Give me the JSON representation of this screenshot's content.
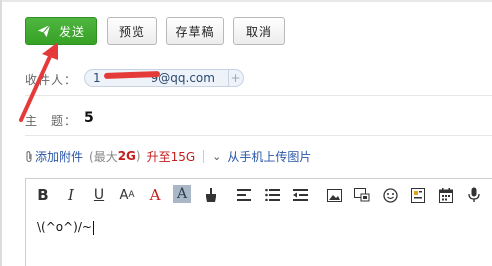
{
  "toolbar": {
    "send_label": "发送",
    "preview_label": "预览",
    "draft_label": "存草稿",
    "cancel_label": "取消"
  },
  "recipient": {
    "label": "收件人：",
    "address_suffix": "9@qq.com",
    "address_prefix_visible": "1",
    "add_symbol": "+"
  },
  "subject": {
    "label": "主　题：",
    "value": "5"
  },
  "attachment": {
    "clip_icon": "paperclip-icon",
    "add_label": "添加附件",
    "limit_open": "(最大",
    "limit_value": "2G",
    "limit_close": ")",
    "upgrade_label": "升至15G",
    "mobile_upload_label": "从手机上传图片"
  },
  "editor": {
    "content": "\\(^o^)/~",
    "tools": [
      "bold-icon",
      "italic-icon",
      "underline-icon",
      "font-size-icon",
      "font-color-icon",
      "highlight-icon",
      "format-brush-icon",
      "align-icon",
      "list-icon",
      "indent-icon",
      "image-icon",
      "screenshot-icon",
      "emoji-icon",
      "template-icon",
      "calendar-icon",
      "voice-icon"
    ]
  },
  "colors": {
    "send_green": "#3aa62a",
    "link_blue": "#2a56a8",
    "warn_red": "#c31d1d",
    "annotation_arrow": "#e53a3a"
  }
}
